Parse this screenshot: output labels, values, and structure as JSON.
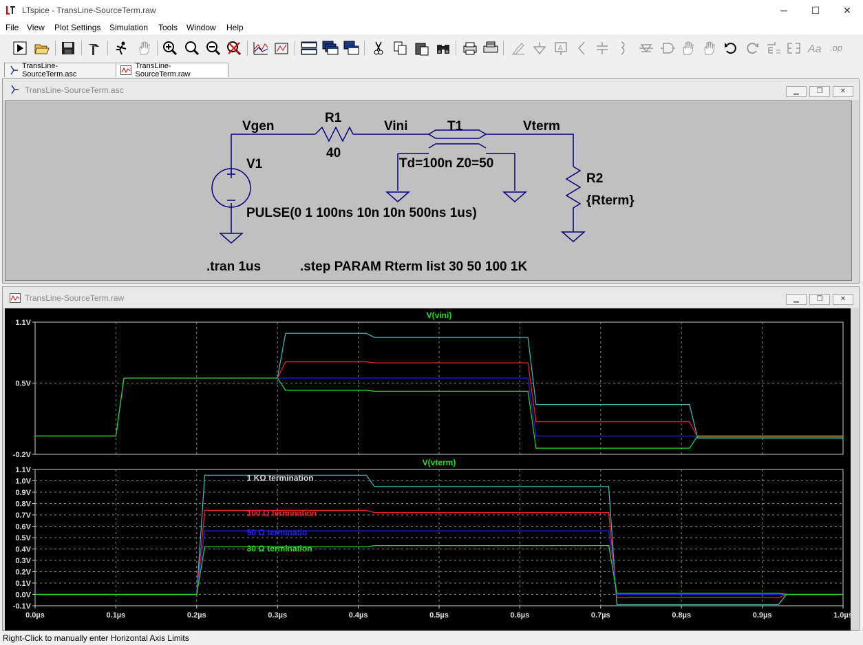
{
  "window": {
    "title": "LTspice - TransLine-SourceTerm.raw",
    "controls": [
      "─",
      "☐",
      "✕"
    ]
  },
  "menu": [
    "File",
    "View",
    "Plot Settings",
    "Simulation",
    "Tools",
    "Window",
    "Help"
  ],
  "toolbar": {
    "buttons": [
      "run",
      "open",
      "save",
      "hammer",
      "runner",
      "pan-hand",
      "zoom-in",
      "zoom-out",
      "zoom-back",
      "zoom-cancel",
      "autorange",
      "draft-probe",
      "tile-horizontal",
      "tile-vertical",
      "cascade",
      "cut",
      "copy",
      "paste",
      "find",
      "print-preview",
      "print",
      "draw-wire",
      "ground",
      "label-net",
      "resistor",
      "capacitor",
      "inductor",
      "diode",
      "component",
      "move",
      "drag",
      "undo",
      "redo",
      "rotate",
      "mirror",
      "text",
      "spice-directive"
    ]
  },
  "tabs": [
    {
      "label": "TransLine-SourceTerm.asc",
      "icon": "schematic-icon",
      "active": false
    },
    {
      "label": "TransLine-SourceTerm.raw",
      "icon": "waveform-icon",
      "active": true
    }
  ],
  "schematic_window": {
    "title": "TransLine-SourceTerm.asc",
    "labels": {
      "vgen": "Vgen",
      "r1": "R1",
      "r1_value": "40",
      "vini": "Vini",
      "t1": "T1",
      "vterm": "Vterm",
      "v1": "V1",
      "t1_params": "Td=100n Z0=50",
      "r2": "R2",
      "r2_value": "{Rterm}",
      "pulse": "PULSE(0 1 100ns 10n 10n 500ns 1us)",
      "tran": ".tran 1us",
      "step": ".step PARAM Rterm list 30 50 100 1K"
    }
  },
  "plot_window": {
    "title": "TransLine-SourceTerm.raw",
    "colors": {
      "c1k": "#40c0c0",
      "c100": "#ff2020",
      "c50": "#2020ff",
      "c30": "#20e020",
      "grid": "#8a8a8a",
      "frame": "#d0d0d0",
      "trace_title": "#20e020"
    }
  },
  "chart_data": [
    {
      "type": "line",
      "title": "V(vini)",
      "xlabel": "",
      "ylabel": "",
      "xlim": [
        0,
        1.0
      ],
      "ylim": [
        -0.2,
        1.1
      ],
      "x_unit": "µs",
      "ytick_labels": [
        "1.1V",
        "0.5V",
        "-0.2V"
      ],
      "grid": true,
      "series": [
        {
          "color": "#40c0c0",
          "x": [
            0,
            0.1,
            0.11,
            0.3,
            0.31,
            0.41,
            0.42,
            0.61,
            0.62,
            0.81,
            0.82,
            1.0
          ],
          "y": [
            -0.02,
            -0.02,
            0.55,
            0.55,
            0.99,
            0.99,
            0.95,
            0.95,
            0.29,
            0.29,
            -0.04,
            -0.04
          ]
        },
        {
          "color": "#ff2020",
          "x": [
            0,
            0.1,
            0.11,
            0.3,
            0.31,
            0.41,
            0.42,
            0.61,
            0.62,
            0.81,
            0.82,
            1.0
          ],
          "y": [
            -0.02,
            -0.02,
            0.55,
            0.55,
            0.71,
            0.71,
            0.7,
            0.7,
            0.12,
            0.12,
            -0.03,
            -0.03
          ]
        },
        {
          "color": "#2020ff",
          "x": [
            0,
            0.1,
            0.11,
            0.3,
            0.31,
            0.41,
            0.42,
            0.61,
            0.62,
            0.81,
            0.82,
            1.0
          ],
          "y": [
            -0.02,
            -0.02,
            0.55,
            0.55,
            0.55,
            0.55,
            0.55,
            0.55,
            -0.02,
            -0.02,
            -0.02,
            -0.02
          ]
        },
        {
          "color": "#20e020",
          "x": [
            0,
            0.1,
            0.11,
            0.3,
            0.31,
            0.41,
            0.42,
            0.61,
            0.62,
            0.81,
            0.82,
            1.0
          ],
          "y": [
            -0.02,
            -0.02,
            0.55,
            0.55,
            0.43,
            0.43,
            0.42,
            0.42,
            -0.14,
            -0.14,
            -0.02,
            -0.02
          ]
        }
      ]
    },
    {
      "type": "line",
      "title": "V(vterm)",
      "xlabel": "",
      "ylabel": "",
      "xlim": [
        0,
        1.0
      ],
      "ylim": [
        -0.1,
        1.1
      ],
      "x_unit": "µs",
      "xtick_labels": [
        "0.0µs",
        "0.1µs",
        "0.2µs",
        "0.3µs",
        "0.4µs",
        "0.5µs",
        "0.6µs",
        "0.7µs",
        "0.8µs",
        "0.9µs",
        "1.0µs"
      ],
      "ytick_labels": [
        "1.1V",
        "1.0V",
        "0.9V",
        "0.8V",
        "0.7V",
        "0.6V",
        "0.5V",
        "0.4V",
        "0.3V",
        "0.2V",
        "0.1V",
        "0.0V",
        "-0.1V"
      ],
      "grid": true,
      "series": [
        {
          "name": "1 KΩ termination",
          "color": "#40c0c0",
          "x": [
            0,
            0.2,
            0.21,
            0.41,
            0.42,
            0.71,
            0.72,
            0.92,
            0.93,
            1.0
          ],
          "y": [
            0,
            0,
            1.05,
            1.05,
            0.95,
            0.95,
            -0.09,
            -0.09,
            0.0,
            0.0
          ]
        },
        {
          "name": "100 Ω termination",
          "color": "#ff2020",
          "x": [
            0,
            0.2,
            0.21,
            0.41,
            0.42,
            0.71,
            0.72,
            0.92,
            0.93,
            1.0
          ],
          "y": [
            0,
            0,
            0.74,
            0.74,
            0.72,
            0.72,
            -0.03,
            -0.03,
            0.0,
            0.0
          ]
        },
        {
          "name": "50 Ω terminatio",
          "color": "#2020ff",
          "x": [
            0,
            0.2,
            0.21,
            0.41,
            0.42,
            0.71,
            0.72,
            0.92,
            0.93,
            1.0
          ],
          "y": [
            0,
            0,
            0.56,
            0.56,
            0.56,
            0.56,
            0.0,
            0.0,
            0.0,
            0.0
          ]
        },
        {
          "name": "30 Ω termination",
          "color": "#20e020",
          "x": [
            0,
            0.2,
            0.21,
            0.41,
            0.42,
            0.71,
            0.72,
            0.92,
            0.93,
            1.0
          ],
          "y": [
            0,
            0,
            0.42,
            0.42,
            0.43,
            0.43,
            0.01,
            0.01,
            0.0,
            0.0
          ]
        }
      ]
    }
  ],
  "status": "Right-Click to manually enter Horizontal Axis Limits"
}
